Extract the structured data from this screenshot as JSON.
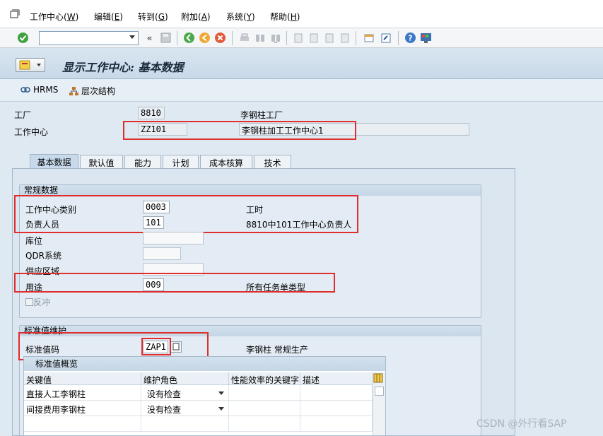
{
  "menu": {
    "items": [
      {
        "label": "工作中心",
        "key": "W"
      },
      {
        "label": "编辑",
        "key": "E"
      },
      {
        "label": "转到",
        "key": "G"
      },
      {
        "label": "附加",
        "key": "A"
      },
      {
        "label": "系统",
        "key": "Y"
      },
      {
        "label": "帮助",
        "key": "H"
      }
    ]
  },
  "toolbar": {
    "command_value": ""
  },
  "title": "显示工作中心: 基本数据",
  "app_toolbar": {
    "hrms_label": "HRMS",
    "hierarchy_label": "层次结构"
  },
  "header": {
    "plant_label": "工厂",
    "plant_value": "8810",
    "plant_desc": "李钢柱工厂",
    "wc_label": "工作中心",
    "wc_value": "ZZ101",
    "wc_desc": "李钢柱加工工作中心1"
  },
  "tabs": [
    {
      "label": "基本数据",
      "active": true
    },
    {
      "label": "默认值",
      "active": false
    },
    {
      "label": "能力",
      "active": false
    },
    {
      "label": "计划",
      "active": false
    },
    {
      "label": "成本核算",
      "active": false
    },
    {
      "label": "技术",
      "active": false
    }
  ],
  "general": {
    "title": "常规数据",
    "category_label": "工作中心类别",
    "category_value": "0003",
    "category_desc": "工时",
    "person_label": "负责人员",
    "person_value": "101",
    "person_desc": "8810中101工作中心负责人",
    "storage_label": "库位",
    "qdr_label": "QDR系统",
    "supply_label": "供应区域",
    "usage_label": "用途",
    "usage_value": "009",
    "usage_desc": "所有任务单类型",
    "backflush_label": "反冲"
  },
  "standard": {
    "title": "标准值维护",
    "key_label": "标准值码",
    "key_value": "ZAP1",
    "key_desc": "李钢柱 常规生产",
    "overview_title": "标准值概览",
    "columns": [
      "关键值",
      "维护角色",
      "性能效率的关键字",
      "描述"
    ],
    "rows": [
      {
        "key": "直接人工李钢柱",
        "role": "没有检查"
      },
      {
        "key": "间接费用李钢柱",
        "role": "没有检查"
      }
    ]
  },
  "watermark": "CSDN @外行看SAP"
}
